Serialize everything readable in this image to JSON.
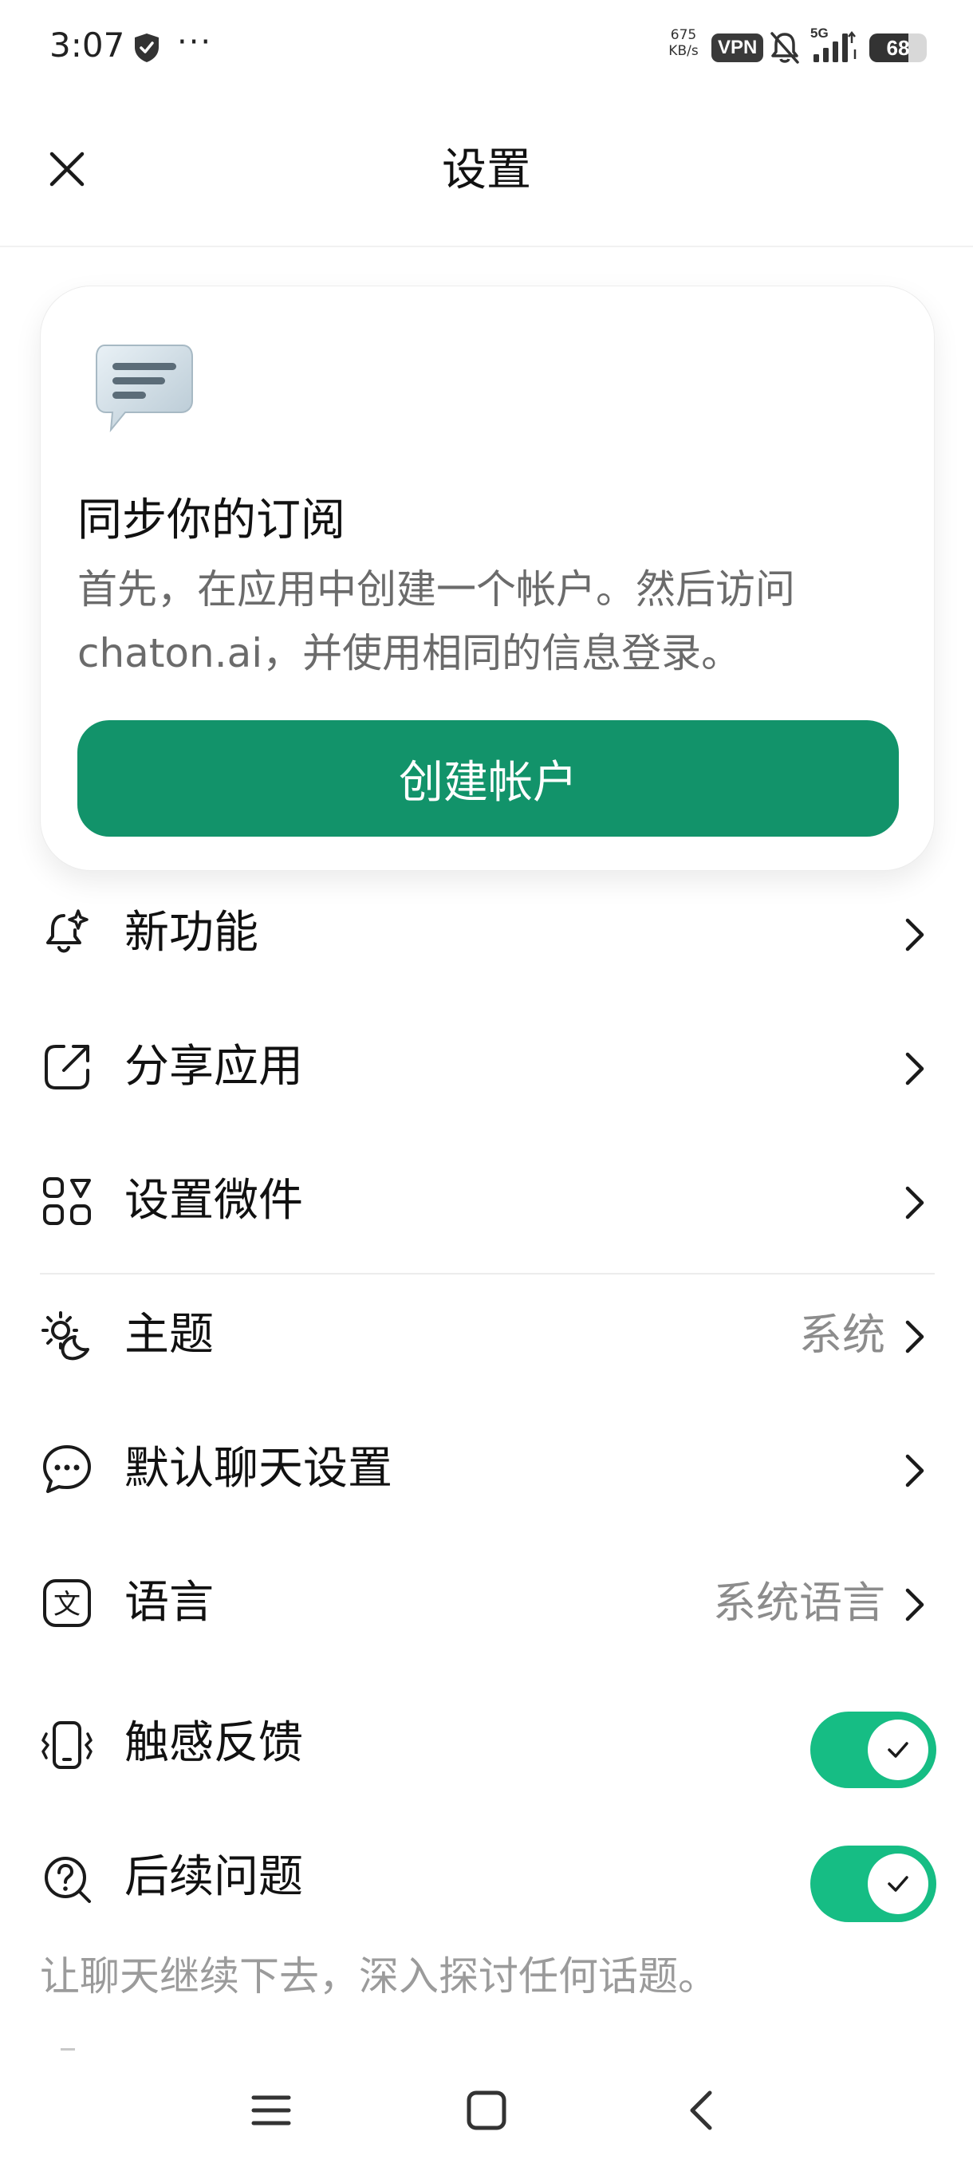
{
  "status_bar": {
    "time": "3:07",
    "speed_value": "675",
    "speed_unit": "KB/s",
    "vpn": "VPN",
    "network": "5G",
    "battery": "68",
    "battery_fraction": 0.68
  },
  "header": {
    "title": "设置",
    "close_icon": "close-icon"
  },
  "sync_card": {
    "icon": "chat-bubble-icon",
    "title": "同步你的订阅",
    "description": "首先，在应用中创建一个帐户。然后访问chaton.ai，并使用相同的信息登录。",
    "button_label": "创建帐户",
    "button_color": "#12936a"
  },
  "menu": {
    "items": [
      {
        "label": "新功能",
        "icon": "bell-sparkle-icon",
        "value": ""
      },
      {
        "label": "分享应用",
        "icon": "share-external-icon",
        "value": ""
      },
      {
        "label": "设置微件",
        "icon": "widgets-icon",
        "value": ""
      },
      {
        "label": "主题",
        "icon": "sun-moon-icon",
        "value": "系统"
      },
      {
        "label": "默认聊天设置",
        "icon": "chat-dots-icon",
        "value": ""
      },
      {
        "label": "语言",
        "icon": "language-icon",
        "value": "系统语言"
      }
    ],
    "toggles": [
      {
        "label": "触感反馈",
        "icon": "vibrate-icon",
        "on": true
      },
      {
        "label": "后续问题",
        "icon": "question-circle-icon",
        "on": true
      }
    ],
    "footnote": "让聊天继续下去，深入探讨任何话题。",
    "toggle_color": "#16bd84"
  },
  "nav_bar": {
    "menu_icon": "menu-icon",
    "home_icon": "home-square-icon",
    "back_icon": "back-chevron-icon"
  }
}
